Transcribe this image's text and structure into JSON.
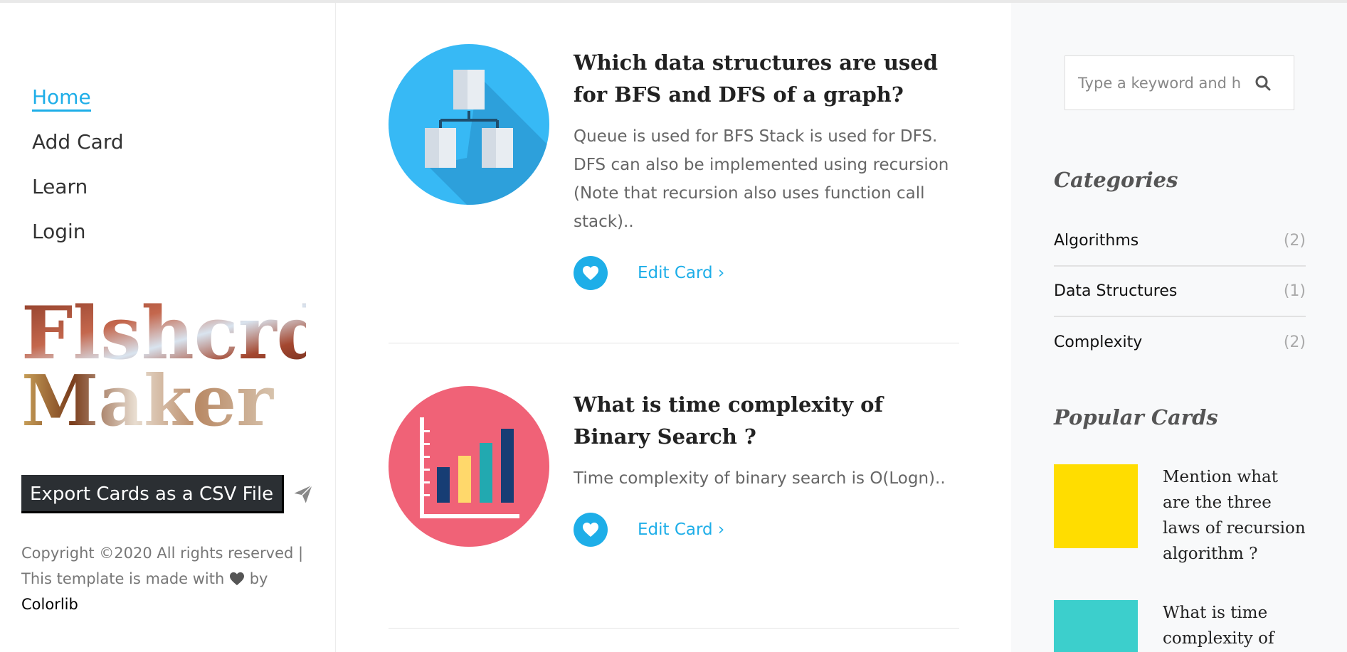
{
  "nav": {
    "items": [
      {
        "label": "Home",
        "active": true
      },
      {
        "label": "Add Card",
        "active": false
      },
      {
        "label": "Learn",
        "active": false
      },
      {
        "label": "Login",
        "active": false
      }
    ]
  },
  "logo": {
    "line1": "Flshcrd",
    "line2": "Maker"
  },
  "export": {
    "label": "Export Cards as a CSV File",
    "icon": "paper-plane-icon"
  },
  "footer": {
    "copyright": "Copyright ©2020 All rights reserved | This template is made with",
    "by": "by",
    "credit": "Colorlib"
  },
  "cards": [
    {
      "title": "Which data structures are used for BFS and DFS of a graph?",
      "text": "Queue is used for BFS Stack is used for DFS. DFS can also be implemented using recursion (Note that recursion also uses function call stack)..",
      "edit_label": "Edit Card",
      "icon": "hierarchy-icon",
      "color": "#37b9f5"
    },
    {
      "title": "What is time complexity of Binary Search ?",
      "text": "Time complexity of binary search is O(Logn)..",
      "edit_label": "Edit Card",
      "icon": "bar-chart-icon",
      "color": "#f06277"
    }
  ],
  "search": {
    "placeholder": "Type a keyword and hit enter"
  },
  "categories": {
    "heading": "Categories",
    "items": [
      {
        "label": "Algorithms",
        "count": "(2)"
      },
      {
        "label": "Data Structures",
        "count": "(1)"
      },
      {
        "label": "Complexity",
        "count": "(2)"
      }
    ]
  },
  "popular": {
    "heading": "Popular Cards",
    "items": [
      {
        "title": "Mention what are the three laws of recursion algorithm ?",
        "color": "#ffdd00"
      },
      {
        "title": "What is time complexity of",
        "color": "#3ccfcc"
      }
    ]
  },
  "colors": {
    "accent": "#1eaee8",
    "dark_button": "#2b2f33"
  }
}
